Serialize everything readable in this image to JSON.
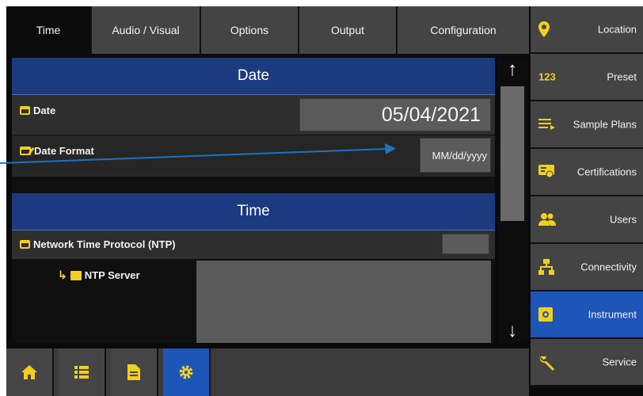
{
  "tabs": [
    {
      "label": "Time",
      "active": true
    },
    {
      "label": "Audio / Visual"
    },
    {
      "label": "Options"
    },
    {
      "label": "Output"
    },
    {
      "label": "Configuration"
    }
  ],
  "date_section": {
    "header": "Date",
    "date_label": "Date",
    "date_value": "05/04/2021",
    "format_label": "Date Format",
    "format_value": "MM/dd/yyyy"
  },
  "time_section": {
    "header": "Time",
    "ntp_label": "Network Time Protocol (NTP)",
    "ntp_server_label": "NTP Server"
  },
  "scroll": {
    "up": "↑",
    "down": "↓"
  },
  "sidebar": {
    "items": [
      {
        "label": "Location",
        "icon": "location-pin-icon"
      },
      {
        "label": "Preset",
        "icon": "123-icon",
        "icon_text": "123"
      },
      {
        "label": "Sample Plans",
        "icon": "list-arrow-icon"
      },
      {
        "label": "Certifications",
        "icon": "certificate-icon"
      },
      {
        "label": "Users",
        "icon": "users-icon"
      },
      {
        "label": "Connectivity",
        "icon": "network-icon"
      },
      {
        "label": "Instrument",
        "icon": "instrument-gear-icon",
        "active": true
      },
      {
        "label": "Service",
        "icon": "wrench-icon"
      }
    ]
  },
  "bottom_bar": {
    "buttons": [
      {
        "name": "home",
        "icon": "home-icon"
      },
      {
        "name": "list",
        "icon": "list-icon"
      },
      {
        "name": "document",
        "icon": "document-icon"
      },
      {
        "name": "settings",
        "icon": "gear-icon",
        "active": true
      }
    ]
  },
  "colors": {
    "accent_yellow": "#f2cf1f",
    "header_blue": "#1c3a80",
    "active_blue": "#1d55b8",
    "annotation_arrow": "#1e73be"
  }
}
